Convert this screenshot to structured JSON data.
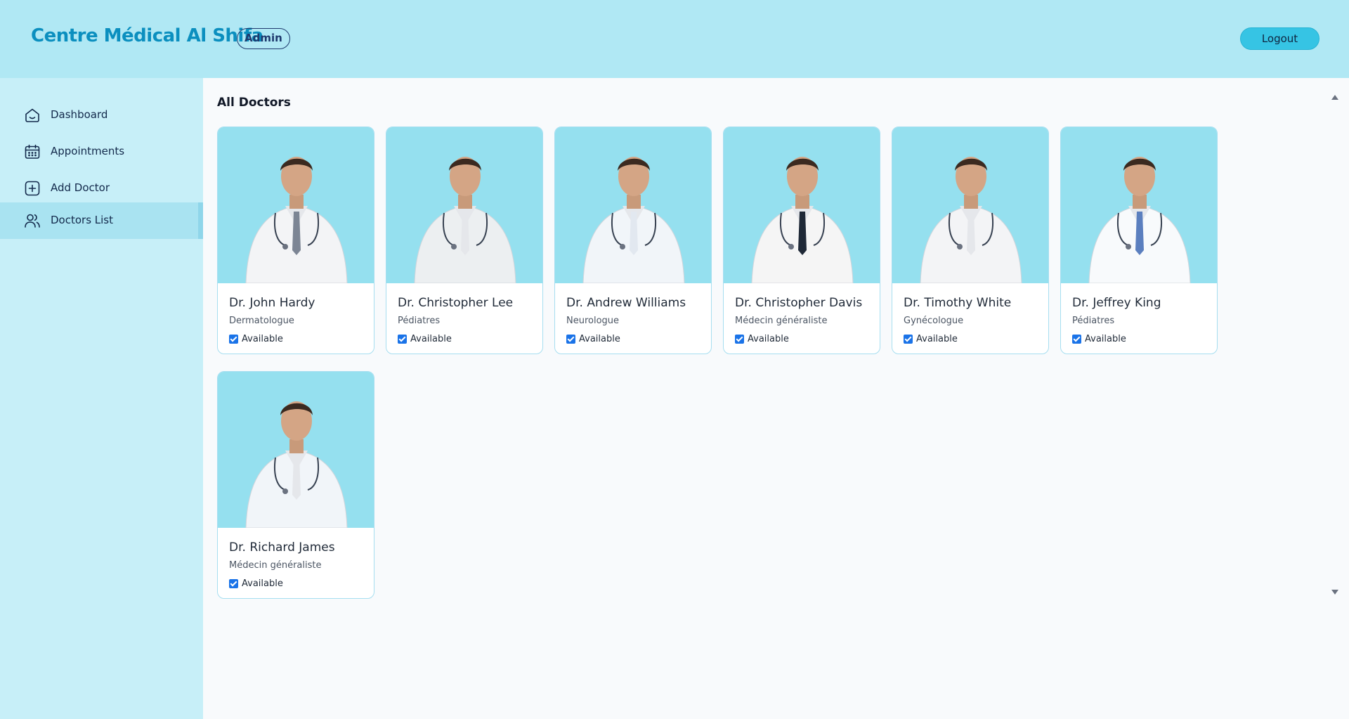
{
  "header": {
    "brand": "Centre Médical Al Shifa",
    "role": "Admin",
    "logout_label": "Logout"
  },
  "sidebar": {
    "items": [
      {
        "label": "Dashboard",
        "icon": "home-icon",
        "active": false
      },
      {
        "label": "Appointments",
        "icon": "calendar-icon",
        "active": false
      },
      {
        "label": "Add Doctor",
        "icon": "add-square-icon",
        "active": false
      },
      {
        "label": "Doctors List",
        "icon": "users-icon",
        "active": true
      }
    ]
  },
  "main": {
    "title": "All Doctors",
    "doctors": [
      {
        "name": "Dr. John Hardy",
        "specialty": "Dermatologue",
        "available": true,
        "availability_label": "Available"
      },
      {
        "name": "Dr. Christopher Lee",
        "specialty": "Pédiatres",
        "available": true,
        "availability_label": "Available"
      },
      {
        "name": "Dr. Andrew Williams",
        "specialty": "Neurologue",
        "available": true,
        "availability_label": "Available"
      },
      {
        "name": "Dr. Christopher Davis",
        "specialty": "Médecin généraliste",
        "available": true,
        "availability_label": "Available"
      },
      {
        "name": "Dr. Timothy White",
        "specialty": "Gynécologue",
        "available": true,
        "availability_label": "Available"
      },
      {
        "name": "Dr. Jeffrey King",
        "specialty": "Pédiatres",
        "available": true,
        "availability_label": "Available"
      },
      {
        "name": "Dr. Richard James",
        "specialty": "Médecin généraliste",
        "available": true,
        "availability_label": "Available"
      }
    ]
  },
  "colors": {
    "header_bg": "#b0e8f4",
    "sidebar_bg": "#c7eff8",
    "sidebar_active_bg": "#a9e3f1",
    "brand": "#0b8fbf",
    "logout_bg": "#36c4e4",
    "photo_bg": "#95e0ef",
    "card_border": "#a6def0",
    "checkbox": "#1a73e8"
  }
}
